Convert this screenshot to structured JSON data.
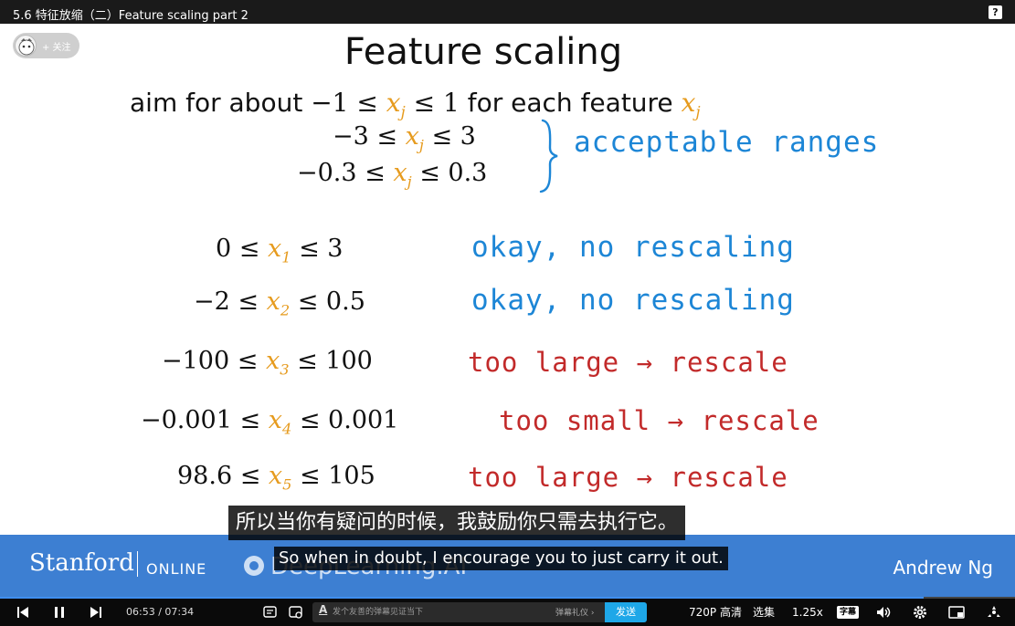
{
  "window": {
    "video_title": "5.6 特征放缩（二）Feature scaling part 2",
    "help_label": "?"
  },
  "uploader": {
    "follow_label": "+ 关注"
  },
  "slide": {
    "title": "Feature scaling",
    "aim_prefix": "aim for about ",
    "aim_math_1": "−1 ≤ ",
    "aim_math_2": " ≤ 1",
    "aim_suffix": " for each feature ",
    "xj": "x",
    "xj_sub": "j",
    "acceptable": [
      {
        "left": "−3 ≤ ",
        "right": " ≤ 3"
      },
      {
        "left": "−0.3 ≤ ",
        "right": " ≤ 0.3"
      }
    ],
    "acceptable_note": "acceptable ranges",
    "features": [
      {
        "left": "0 ≤ ",
        "sub": "1",
        "right": " ≤ 3",
        "note": "okay, no rescaling"
      },
      {
        "left": "−2 ≤ ",
        "sub": "2",
        "right": " ≤ 0.5",
        "note": "okay, no rescaling"
      },
      {
        "left": "−100 ≤ ",
        "sub": "3",
        "right": " ≤ 100",
        "note": "too large → rescale"
      },
      {
        "left": "−0.001 ≤ ",
        "sub": "4",
        "right": " ≤ 0.001",
        "note": "too small → rescale"
      },
      {
        "left": "98.6 ≤ ",
        "sub": "5",
        "right": " ≤ 105",
        "note": "too large → rescale"
      }
    ]
  },
  "subtitles": {
    "cn": "所以当你有疑问的时候，我鼓励你只需去执行它。",
    "en": "So when in doubt, I encourage you to just carry it out."
  },
  "band": {
    "stanford": "Stanford",
    "online": "ONLINE",
    "deeplearning": "DeepLearning.AI",
    "andrew": "Andrew Ng"
  },
  "player": {
    "current_time": "06:53",
    "time_separator": "/",
    "total_time": "07:34",
    "progress": 0.91,
    "danmaku_placeholder": "发个友善的弹幕见证当下",
    "danmaku_etiquette": "弹幕礼仪 ›",
    "send_label": "发送",
    "quality_label": "720P 高清",
    "episodes_label": "选集",
    "speed_label": "1.25x",
    "subtitle_label": "字幕"
  },
  "colors": {
    "accent_blue": "#3d7fd2",
    "variable_orange": "#e69b1e",
    "hand_blue": "#1d86d6",
    "hand_red": "#c22a2a"
  }
}
